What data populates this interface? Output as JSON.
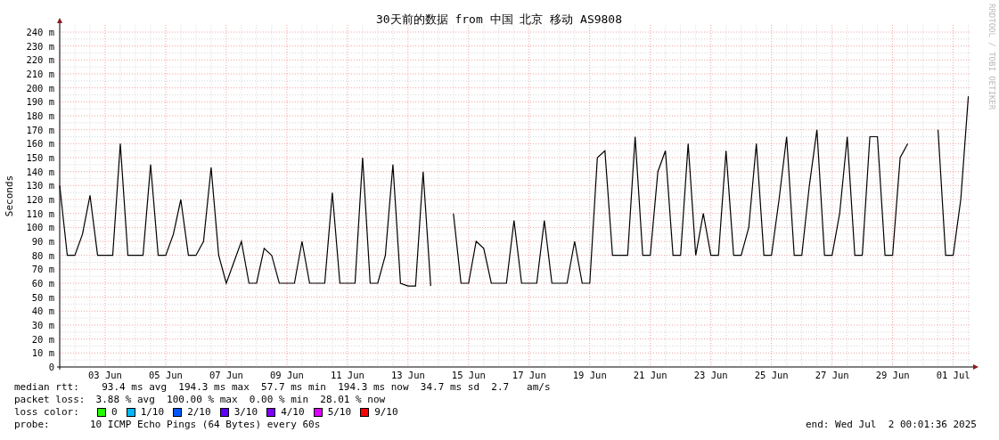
{
  "watermark": "RRDTOOL / TOBI OETIKER",
  "chart": {
    "chart_data": {
      "type": "line",
      "title": "30天前的数据 from 中国 北京 移动 AS9808",
      "ylabel": "Seconds",
      "ylim": [
        0,
        240
      ],
      "grid": true,
      "categories": [
        null,
        null,
        null,
        null,
        null,
        null,
        "03 Jun",
        null,
        null,
        null,
        null,
        null,
        null,
        null,
        "05 Jun",
        null,
        null,
        null,
        null,
        null,
        null,
        null,
        "07 Jun",
        null,
        null,
        null,
        null,
        null,
        null,
        null,
        "09 Jun",
        null,
        null,
        null,
        null,
        null,
        null,
        null,
        "11 Jun",
        null,
        null,
        null,
        null,
        null,
        null,
        null,
        "13 Jun",
        null,
        null,
        null,
        null,
        null,
        null,
        null,
        "15 Jun",
        null,
        null,
        null,
        null,
        null,
        null,
        null,
        "17 Jun",
        null,
        null,
        null,
        null,
        null,
        null,
        null,
        "19 Jun",
        null,
        null,
        null,
        null,
        null,
        null,
        null,
        "21 Jun",
        null,
        null,
        null,
        null,
        null,
        null,
        null,
        "23 Jun",
        null,
        null,
        null,
        null,
        null,
        null,
        null,
        "25 Jun",
        null,
        null,
        null,
        null,
        null,
        null,
        null,
        "27 Jun",
        null,
        null,
        null,
        null,
        null,
        null,
        null,
        "29 Jun",
        null,
        null,
        null,
        null,
        null,
        null,
        null,
        "01 Jul",
        null,
        null
      ],
      "yticks": [
        {
          "value": 0,
          "label": "0"
        },
        {
          "value": 10,
          "label": "10 m"
        },
        {
          "value": 20,
          "label": "20 m"
        },
        {
          "value": 30,
          "label": "30 m"
        },
        {
          "value": 40,
          "label": "40 m"
        },
        {
          "value": 50,
          "label": "50 m"
        },
        {
          "value": 60,
          "label": "60 m"
        },
        {
          "value": 70,
          "label": "70 m"
        },
        {
          "value": 80,
          "label": "80 m"
        },
        {
          "value": 90,
          "label": "90 m"
        },
        {
          "value": 100,
          "label": "100 m"
        },
        {
          "value": 110,
          "label": "110 m"
        },
        {
          "value": 120,
          "label": "120 m"
        },
        {
          "value": 130,
          "label": "130 m"
        },
        {
          "value": 140,
          "label": "140 m"
        },
        {
          "value": 150,
          "label": "150 m"
        },
        {
          "value": 160,
          "label": "160 m"
        },
        {
          "value": 170,
          "label": "170 m"
        },
        {
          "value": 180,
          "label": "180 m"
        },
        {
          "value": 190,
          "label": "190 m"
        },
        {
          "value": 200,
          "label": "200 m"
        },
        {
          "value": 210,
          "label": "210 m"
        },
        {
          "value": 220,
          "label": "220 m"
        },
        {
          "value": 230,
          "label": "230 m"
        },
        {
          "value": 240,
          "label": "240 m"
        }
      ],
      "series": [
        {
          "name": "median rtt:",
          "color": "#000000",
          "values": [
            130,
            80,
            80,
            95,
            123,
            80,
            80,
            80,
            160,
            80,
            80,
            80,
            145,
            80,
            80,
            95,
            120,
            80,
            80,
            90,
            143,
            80,
            60,
            75,
            90,
            60,
            60,
            85,
            80,
            60,
            60,
            60,
            90,
            60,
            60,
            60,
            125,
            60,
            60,
            60,
            150,
            60,
            60,
            80,
            145,
            60,
            58,
            58,
            140,
            58,
            null,
            null,
            110,
            60,
            60,
            90,
            85,
            60,
            60,
            60,
            105,
            60,
            60,
            60,
            105,
            60,
            60,
            60,
            90,
            60,
            60,
            150,
            155,
            80,
            80,
            80,
            165,
            80,
            80,
            140,
            155,
            80,
            80,
            160,
            80,
            110,
            80,
            80,
            155,
            80,
            80,
            100,
            160,
            80,
            80,
            120,
            165,
            80,
            80,
            130,
            170,
            80,
            80,
            110,
            165,
            80,
            80,
            165,
            165,
            80,
            80,
            150,
            160,
            null,
            null,
            null,
            170,
            80,
            80,
            120,
            194
          ]
        }
      ]
    }
  },
  "legend": {
    "rows": [
      {
        "value": "  93.4 ms avg  194.3 ms max  57.7 ms min  194.3 ms now  34.7 ms sd  2.7   am/s"
      },
      {
        "label": "packet loss:",
        "value": " 3.88 % avg  100.00 % max  0.00 % min  28.01 % now"
      }
    ],
    "loss_label": "loss color:",
    "loss_colors": [
      {
        "label": "0",
        "color": "#26ff00"
      },
      {
        "label": "1/10",
        "color": "#00b8ff"
      },
      {
        "label": "2/10",
        "color": "#0059ff"
      },
      {
        "label": "3/10",
        "color": "#5e00ff"
      },
      {
        "label": "4/10",
        "color": "#7e00ff"
      },
      {
        "label": "5/10",
        "color": "#dd00ff"
      },
      {
        "label": "9/10",
        "color": "#ff0000"
      }
    ],
    "probe_label": "probe:",
    "probe": "10 ICMP Echo Pings (64 Bytes) every 60s",
    "end": "end: Wed Jul  2 00:01:36 2025"
  }
}
